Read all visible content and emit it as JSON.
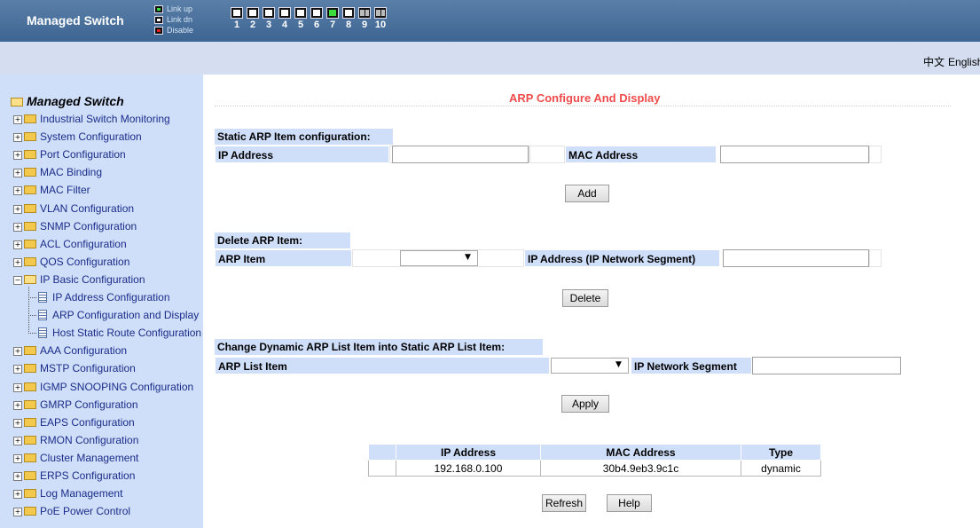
{
  "header": {
    "brand": "Managed Switch",
    "legend": [
      {
        "label": "Link up",
        "icon": "port-link-up-icon",
        "state": "up"
      },
      {
        "label": "Link dn",
        "icon": "port-link-down-icon",
        "state": "dn"
      },
      {
        "label": "Disable",
        "icon": "port-disabled-icon",
        "state": "dis"
      }
    ],
    "ports": [
      {
        "num": "1",
        "state": "dn"
      },
      {
        "num": "2",
        "state": "dn"
      },
      {
        "num": "3",
        "state": "dn"
      },
      {
        "num": "4",
        "state": "dn"
      },
      {
        "num": "5",
        "state": "dn"
      },
      {
        "num": "6",
        "state": "dn"
      },
      {
        "num": "7",
        "state": "up"
      },
      {
        "num": "8",
        "state": "dn"
      },
      {
        "num": "9",
        "state": "fiber"
      },
      {
        "num": "10",
        "state": "fiber"
      }
    ]
  },
  "lang": {
    "zh": "中文",
    "en": "English"
  },
  "sidebar": {
    "root": "Managed Switch",
    "items": [
      "Industrial Switch Monitoring",
      "System Configuration",
      "Port Configuration",
      "MAC Binding",
      "MAC Filter",
      "VLAN Configuration",
      "SNMP Configuration",
      "ACL Configuration",
      "QOS Configuration",
      "IP Basic Configuration",
      "AAA Configuration",
      "MSTP Configuration",
      "IGMP SNOOPING Configuration",
      "GMRP Configuration",
      "EAPS Configuration",
      "RMON Configuration",
      "Cluster Management",
      "ERPS Configuration",
      "Log Management",
      "PoE Power Control"
    ],
    "subitems": [
      "IP Address Configuration",
      "ARP Configuration and Display",
      "Host Static Route Configuration"
    ]
  },
  "main": {
    "title": "ARP Configure And Display",
    "static": {
      "heading": "Static ARP Item configuration:",
      "ip_label": "IP Address",
      "ip_value": "",
      "mac_label": "MAC Address",
      "mac_value": "",
      "add_button": "Add"
    },
    "delete": {
      "heading": "Delete ARP Item:",
      "item_label": "ARP Item",
      "item_value": "",
      "ip_label": "IP Address (IP Network Segment)",
      "ip_value": "",
      "delete_button": "Delete"
    },
    "change": {
      "heading": "Change Dynamic ARP List Item into Static ARP List Item:",
      "item_label": "ARP List Item",
      "item_value": "",
      "segment_label": "IP Network Segment",
      "segment_value": "",
      "apply_button": "Apply"
    },
    "table": {
      "headers": [
        "",
        "IP Address",
        "MAC Address",
        "Type"
      ],
      "rows": [
        {
          "check": "",
          "ip": "192.168.0.100",
          "mac": "30b4.9eb3.9c1c",
          "type": "dynamic"
        }
      ]
    },
    "refresh_button": "Refresh",
    "help_button": "Help"
  },
  "colors": {
    "header_bg": "#3d6592",
    "subbar_bg": "#d4def0",
    "sidebar_bg": "#cfdffa",
    "label_bg": "#cfdffa",
    "title_color": "#ef4b4b",
    "tree_text": "#1a2c88"
  }
}
